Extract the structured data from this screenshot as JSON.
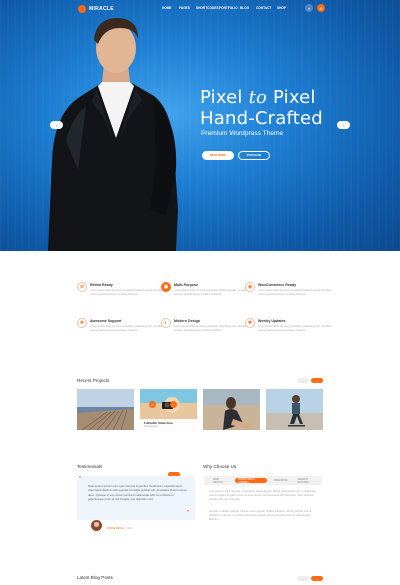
{
  "brand": {
    "logo_text": "MIRACLE",
    "accent": "#ff6a13",
    "hero_blue": "#1e7fd4"
  },
  "nav": {
    "menu": [
      "HOME",
      "PAGES",
      "SHORTCODES",
      "PORTFOLIO",
      "BLOG",
      "CONTACT",
      "SHOP"
    ],
    "icons": [
      "search-icon",
      "cart-icon"
    ]
  },
  "hero": {
    "title_line1_a": "Pixel ",
    "title_line1_b": "to",
    "title_line1_c": " Pixel",
    "title_line2": "Hand-Crafted",
    "subtitle": "Premium Wordpress Theme",
    "btn_primary": "READ MORE",
    "btn_secondary": "PURCHASE",
    "prev_arrow": "‹",
    "next_arrow": "›"
  },
  "features": [
    {
      "icon": "⊕",
      "title": "Retina Ready",
      "text": "Lorem ipsum dolor sit amet consetetur sadipscing elitr, sed diam nonumy eirmod tempor invidunt ut labore."
    },
    {
      "icon": "▣",
      "title": "Multi-Purpose",
      "text": "Lorem ipsum dolor sit amet consetetur sadipscing elitr, sed diam nonumy eirmod tempor invidunt ut labore."
    },
    {
      "icon": "◉",
      "title": "WooCommerce Ready",
      "text": "Lorem ipsum dolor sit amet consetetur sadipscing elitr, sed diam nonumy eirmod tempor invidunt ut labore."
    },
    {
      "icon": "✚",
      "title": "Awesome Support",
      "text": "Lorem ipsum dolor sit amet consetetur sadipscing elitr, sed diam nonumy eirmod tempor invidunt ut labore."
    },
    {
      "icon": "◐",
      "title": "Modern Design",
      "text": "Lorem ipsum dolor sit amet consetetur sadipscing elitr, sed diam nonumy eirmod tempor invidunt ut labore."
    },
    {
      "icon": "✱",
      "title": "Weekly Updates",
      "text": "Lorem ipsum dolor sit amet consetetur sadipscing elitr, sed diam nonumy eirmod tempor invidunt ut labore."
    }
  ],
  "projects": {
    "title": "Recent Projects",
    "pager": {
      "prev": "‹",
      "next": "›"
    },
    "featured_caption": {
      "title": "Fullwidth Slideshow",
      "category": "Photography"
    }
  },
  "testimonials": {
    "title": "Testimonials",
    "pager": {
      "prev": "‹",
      "next": "›"
    },
    "quote": "Maecenas mentum enim quis rhoncus imperdiet. Vestibulum vulputate lacus vitae ligula dapibus nibh egestas convallis pulvinar elit, at sodales libero tempus diam. Quisque et est cursus hendrerit malesuada nibh vel vehicula ut pellentesque tortor at nisl fringilla, non dignissim nisl.",
    "author_name": "JANICE DEVIA",
    "author_role": " – CEO"
  },
  "why": {
    "title": "Why Choose Us",
    "tabs": [
      "WEB DESIGN",
      "WORDPRESS THEMES",
      "BRANDING",
      "SEARCH ENGINES"
    ],
    "para1": "Lorem ipsum dolor sit amet, consectetur adipiscing elit. Sed id pellentesque leo, in sollicitudin mauris. Nullam fringilla cursus sit amet lacinia, vel consequat nibh dignissim. Nam vehicula lobortis velit nec commodo.",
    "para2": "Aenean in aliquet tristique. Aliquam erat volutpat. Nullam interdum velit at, facilisis viverra. Vestibulum vel arcu nec dolor scelerisque semper. Donec interdum diam at pellentesque lobortis."
  },
  "blog": {
    "title": "Latest Blog Posts",
    "pager": {
      "prev": "‹",
      "next": "›"
    }
  }
}
